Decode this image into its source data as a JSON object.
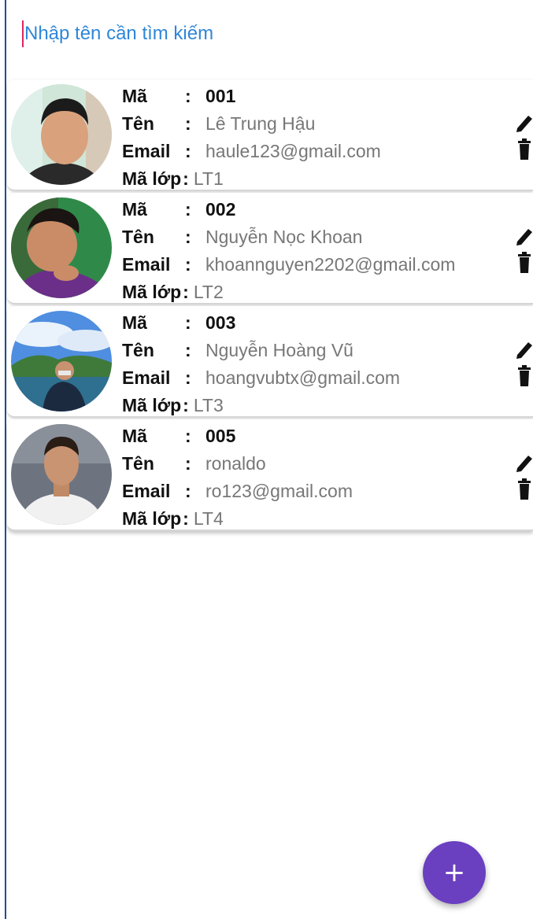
{
  "search": {
    "placeholder": "Nhập tên cần tìm kiếm",
    "value": ""
  },
  "labels": {
    "ma": "Mã",
    "ten": "Tên",
    "email": "Email",
    "ma_lop": "Mã lớp",
    "colon": ":"
  },
  "students": [
    {
      "ma": "001",
      "ten": "Lê Trung Hậu",
      "email": "haule123@gmail.com",
      "ma_lop": "LT1"
    },
    {
      "ma": "002",
      "ten": "Nguyễn Nọc Khoan",
      "email": "khoannguyen2202@gmail.com",
      "ma_lop": "LT2"
    },
    {
      "ma": "003",
      "ten": "Nguyễn Hoàng Vũ",
      "email": "hoangvubtx@gmail.com",
      "ma_lop": "LT3"
    },
    {
      "ma": "005",
      "ten": "ronaldo",
      "email": "ro123@gmail.com",
      "ma_lop": "LT4"
    }
  ],
  "fab": {
    "icon": "plus-icon",
    "label": "+"
  },
  "colors": {
    "accent": "#6a3fc0",
    "search_text": "#2f86d8"
  }
}
